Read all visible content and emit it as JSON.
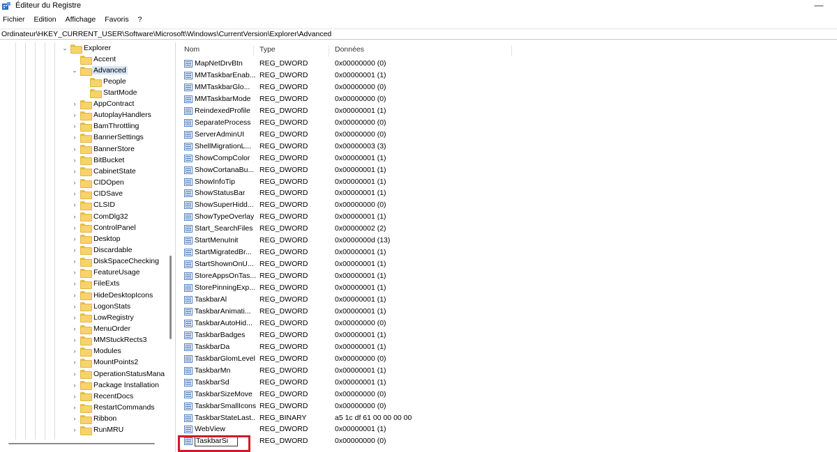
{
  "window": {
    "title": "Éditeur du Registre",
    "minimize_glyph": "—"
  },
  "menu": [
    "Fichier",
    "Edition",
    "Affichage",
    "Favoris",
    "?"
  ],
  "address": "Ordinateur\\HKEY_CURRENT_USER\\Software\\Microsoft\\Windows\\CurrentVersion\\Explorer\\Advanced",
  "tree": {
    "explorer": "Explorer",
    "accent": "Accent",
    "advanced": "Advanced",
    "people": "People",
    "startmode": "StartMode",
    "items": [
      "AppContract",
      "AutoplayHandlers",
      "BamThrottling",
      "BannerSettings",
      "BannerStore",
      "BitBucket",
      "CabinetState",
      "CIDOpen",
      "CIDSave",
      "CLSID",
      "ComDlg32",
      "ControlPanel",
      "Desktop",
      "Discardable",
      "DiskSpaceChecking",
      "FeatureUsage",
      "FileExts",
      "HideDesktopIcons",
      "LogonStats",
      "LowRegistry",
      "MenuOrder",
      "MMStuckRects3",
      "Modules",
      "MountPoints2",
      "OperationStatusMana",
      "Package Installation",
      "RecentDocs",
      "RestartCommands",
      "Ribbon",
      "RunMRU"
    ]
  },
  "columns": {
    "name": "Nom",
    "type": "Type",
    "data": "Données"
  },
  "values": [
    {
      "name": "MapNetDrvBtn",
      "type": "REG_DWORD",
      "data": "0x00000000 (0)"
    },
    {
      "name": "MMTaskbarEnab...",
      "type": "REG_DWORD",
      "data": "0x00000001 (1)"
    },
    {
      "name": "MMTaskbarGlo...",
      "type": "REG_DWORD",
      "data": "0x00000000 (0)"
    },
    {
      "name": "MMTaskbarMode",
      "type": "REG_DWORD",
      "data": "0x00000000 (0)"
    },
    {
      "name": "ReindexedProfile",
      "type": "REG_DWORD",
      "data": "0x00000001 (1)"
    },
    {
      "name": "SeparateProcess",
      "type": "REG_DWORD",
      "data": "0x00000000 (0)"
    },
    {
      "name": "ServerAdminUI",
      "type": "REG_DWORD",
      "data": "0x00000000 (0)"
    },
    {
      "name": "ShellMigrationL...",
      "type": "REG_DWORD",
      "data": "0x00000003 (3)"
    },
    {
      "name": "ShowCompColor",
      "type": "REG_DWORD",
      "data": "0x00000001 (1)"
    },
    {
      "name": "ShowCortanaBu...",
      "type": "REG_DWORD",
      "data": "0x00000001 (1)"
    },
    {
      "name": "ShowInfoTip",
      "type": "REG_DWORD",
      "data": "0x00000001 (1)"
    },
    {
      "name": "ShowStatusBar",
      "type": "REG_DWORD",
      "data": "0x00000001 (1)"
    },
    {
      "name": "ShowSuperHidd...",
      "type": "REG_DWORD",
      "data": "0x00000000 (0)"
    },
    {
      "name": "ShowTypeOverlay",
      "type": "REG_DWORD",
      "data": "0x00000001 (1)"
    },
    {
      "name": "Start_SearchFiles",
      "type": "REG_DWORD",
      "data": "0x00000002 (2)"
    },
    {
      "name": "StartMenuInit",
      "type": "REG_DWORD",
      "data": "0x0000000d (13)"
    },
    {
      "name": "StartMigratedBr...",
      "type": "REG_DWORD",
      "data": "0x00000001 (1)"
    },
    {
      "name": "StartShownOnU...",
      "type": "REG_DWORD",
      "data": "0x00000001 (1)"
    },
    {
      "name": "StoreAppsOnTas...",
      "type": "REG_DWORD",
      "data": "0x00000001 (1)"
    },
    {
      "name": "StorePinningExp...",
      "type": "REG_DWORD",
      "data": "0x00000001 (1)"
    },
    {
      "name": "TaskbarAl",
      "type": "REG_DWORD",
      "data": "0x00000001 (1)"
    },
    {
      "name": "TaskbarAnimati...",
      "type": "REG_DWORD",
      "data": "0x00000001 (1)"
    },
    {
      "name": "TaskbarAutoHid...",
      "type": "REG_DWORD",
      "data": "0x00000000 (0)"
    },
    {
      "name": "TaskbarBadges",
      "type": "REG_DWORD",
      "data": "0x00000001 (1)"
    },
    {
      "name": "TaskbarDa",
      "type": "REG_DWORD",
      "data": "0x00000001 (1)"
    },
    {
      "name": "TaskbarGlomLevel",
      "type": "REG_DWORD",
      "data": "0x00000000 (0)"
    },
    {
      "name": "TaskbarMn",
      "type": "REG_DWORD",
      "data": "0x00000001 (1)"
    },
    {
      "name": "TaskbarSd",
      "type": "REG_DWORD",
      "data": "0x00000001 (1)"
    },
    {
      "name": "TaskbarSizeMove",
      "type": "REG_DWORD",
      "data": "0x00000000 (0)"
    },
    {
      "name": "TaskbarSmallIcons",
      "type": "REG_DWORD",
      "data": "0x00000000 (0)"
    },
    {
      "name": "TaskbarStateLast...",
      "type": "REG_BINARY",
      "data": "a5 1c df 61 00 00 00 00"
    },
    {
      "name": "WebView",
      "type": "REG_DWORD",
      "data": "0x00000001 (1)"
    },
    {
      "name": "TaskbarSi",
      "type": "REG_DWORD",
      "data": "0x00000000 (0)"
    }
  ]
}
